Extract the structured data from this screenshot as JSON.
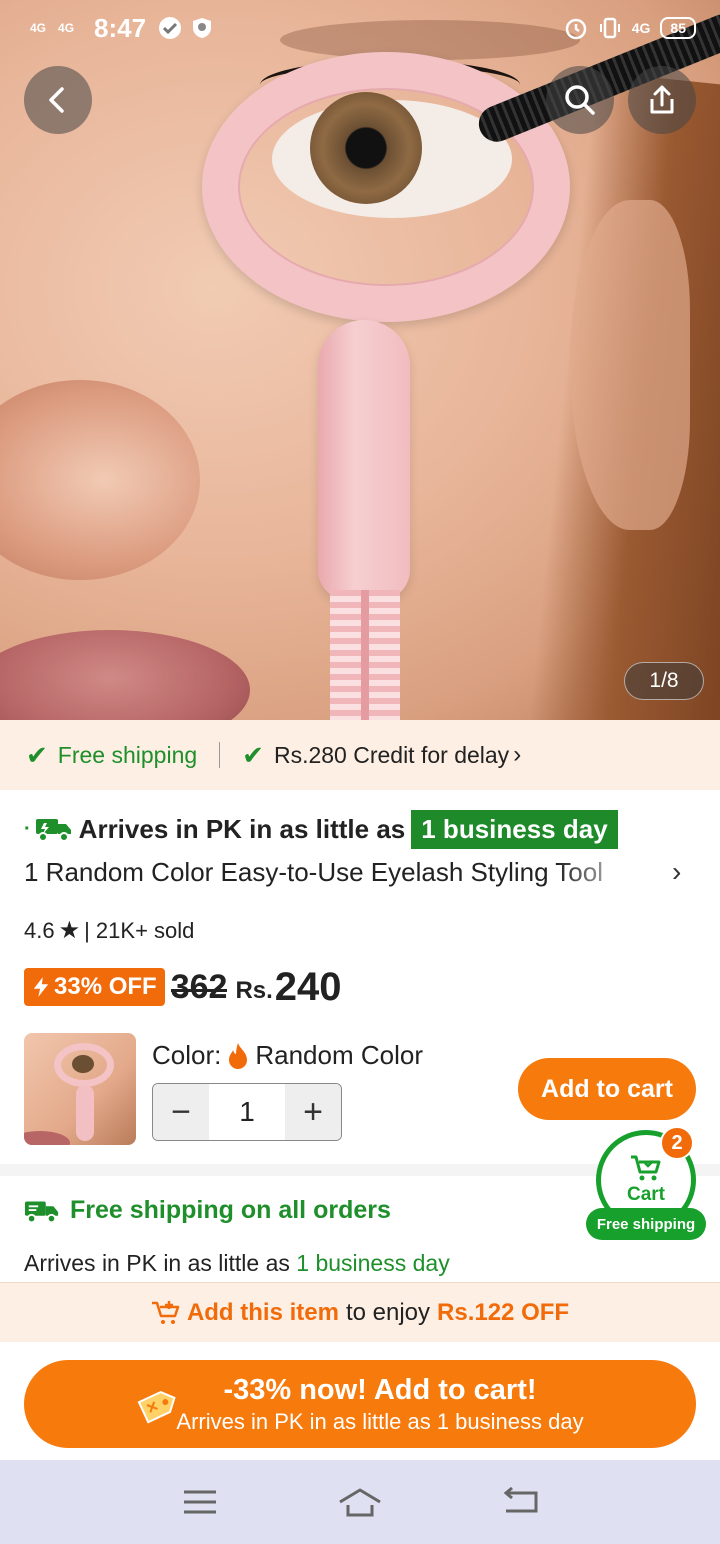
{
  "status_bar": {
    "signal_1": "4G",
    "signal_2": "4G",
    "time": "8:47",
    "network_right": "4G",
    "battery": "85"
  },
  "hero": {
    "page_indicator": "1/8"
  },
  "benefits": {
    "free_shipping": "Free shipping",
    "credit": "Rs.280 Credit for delay",
    "credit_chevron": "›"
  },
  "product": {
    "arrive_prefix": "Arrives in PK in as little as",
    "arrive_badge": "1 business day",
    "title": "1 Random Color Easy-to-Use Eyelash Styling Tool",
    "rating": "4.6",
    "sold": "| 21K+ sold",
    "discount_badge": "33% OFF",
    "old_price": "362",
    "currency": "Rs.",
    "price": "240",
    "color_label": "Color:",
    "color_value": "Random Color",
    "quantity": "1",
    "minus": "−",
    "plus": "+",
    "add_to_cart": "Add to cart"
  },
  "shipping": {
    "headline": "Free shipping on all orders",
    "sub_prefix": "Arrives in PK in as little as",
    "sub_highlight": "1 business day"
  },
  "floating_cart": {
    "label": "Cart",
    "count": "2",
    "free_shipping": "Free shipping"
  },
  "promo": {
    "add_this_item": "Add this item",
    "to_enjoy": "to enjoy",
    "discount": "Rs.122 OFF"
  },
  "cta": {
    "line1": "-33% now! Add to cart!",
    "line2": "Arrives in PK in as little as 1 business day"
  },
  "colors": {
    "accent_orange": "#f77a0c",
    "green": "#1e8f2a",
    "cream": "#fdefe3"
  }
}
